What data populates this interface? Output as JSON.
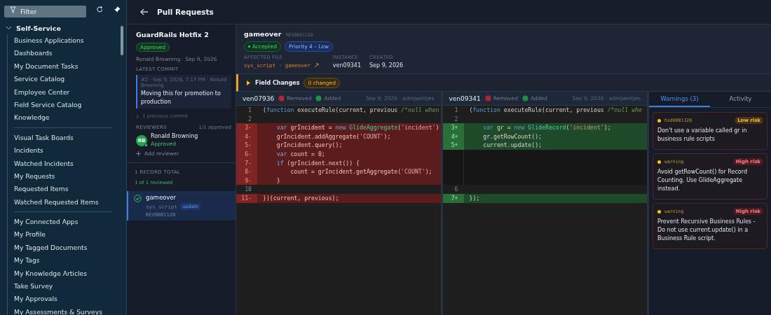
{
  "sidebar": {
    "filter": {
      "placeholder": "Filter"
    },
    "sections": [
      {
        "label": "Self-Service",
        "expanded": true,
        "groups": [
          [
            "Business Applications",
            "Dashboards",
            "My Document Tasks",
            "Service Catalog",
            "Employee Center",
            "Field Service Catalog",
            "Knowledge"
          ],
          [
            "Visual Task Boards",
            "Incidents",
            "Watched Incidents",
            "My Requests",
            "Requested Items",
            "Watched Requested Items"
          ],
          [
            "My Connected Apps",
            "My Profile",
            "My Tagged Documents",
            "My Tags",
            "My Knowledge Articles",
            "Take Survey",
            "My Approvals",
            "My Assessments & Surveys"
          ]
        ]
      }
    ]
  },
  "header": {
    "title": "Pull Requests"
  },
  "pull_request": {
    "title": "GuardRails Hotfix 2",
    "status": "Approved",
    "meta": "Ronald Browning · Sep 9, 2026",
    "latest_commit_label": "LATEST COMMIT",
    "commit": {
      "meta": "#2 · Sep 9, 2026, 7:17 PM · Ronald Browning",
      "message": "Moving this for promotion to production"
    },
    "previous_commits": "1 previous commit",
    "reviewers_label": "REVIEWERS",
    "reviewers_count": "1/1 approved",
    "reviewers": [
      {
        "initials": "RB",
        "name": "Ronald Browning",
        "status": "Approved"
      }
    ],
    "add_reviewer": "Add reviewer",
    "records_label": "1 RECORD TOTAL",
    "reviewed": "1 of 1 reviewed",
    "all_reviewed": true,
    "records": [
      {
        "name": "gameover",
        "table": "sys_script",
        "action": "update",
        "id": "REV0001120",
        "reviewed": true,
        "selected": true
      }
    ]
  },
  "record": {
    "name": "gameover",
    "id": "REV0001120",
    "status": "Accepted",
    "priority": "Priority 4 – Low",
    "fields": [
      {
        "label": "AFFECTED FILE",
        "value": "sys_script · gameover",
        "kind": "file"
      },
      {
        "label": "INSTANCE",
        "value": "ven09341",
        "kind": "plain"
      },
      {
        "label": "CREATED",
        "value": "Sep 9, 2026",
        "kind": "plain"
      }
    ]
  },
  "field_changes": {
    "label": "Field Changes",
    "count": "0 changed",
    "expanded": false
  },
  "diff_panes": [
    {
      "instance": "ven07936",
      "legend": [
        {
          "kind": "removed",
          "label": "Removed"
        },
        {
          "kind": "added",
          "label": "Added"
        }
      ],
      "meta": "Sep 9, 2026 · admjwintjes",
      "lines": [
        {
          "kind": "context",
          "num": "1",
          "tokens": [
            {
              "kind": "plain",
              "text": "("
            },
            {
              "kind": "kw",
              "text": "function"
            },
            {
              "kind": "plain",
              "text": " executeRule(current, previous "
            },
            {
              "kind": "comment",
              "text": "/*null when"
            }
          ]
        },
        {
          "kind": "context",
          "num": "2"
        },
        {
          "kind": "removed",
          "num": "3-",
          "tokens": [
            {
              "kind": "kw",
              "text": "    var"
            },
            {
              "kind": "plain",
              "text": " grIncident = "
            },
            {
              "kind": "kw",
              "text": "new "
            },
            {
              "kind": "cls",
              "text": "GlideAggregate"
            },
            {
              "kind": "plain",
              "text": "("
            },
            {
              "kind": "str",
              "text": "'incident'"
            },
            {
              "kind": "plain",
              "text": ")"
            }
          ]
        },
        {
          "kind": "removed",
          "num": "4-",
          "tokens": [
            {
              "kind": "plain",
              "text": "    grIncident.addAggregate("
            },
            {
              "kind": "str",
              "text": "'COUNT'"
            },
            {
              "kind": "plain",
              "text": ");"
            }
          ]
        },
        {
          "kind": "removed",
          "num": "5-",
          "tokens": [
            {
              "kind": "plain",
              "text": "    grIncident.query();"
            }
          ]
        },
        {
          "kind": "removed",
          "num": "6-",
          "tokens": [
            {
              "kind": "kw",
              "text": "    var"
            },
            {
              "kind": "plain",
              "text": " count = 0;"
            }
          ]
        },
        {
          "kind": "removed",
          "num": "7-",
          "tokens": [
            {
              "kind": "kw",
              "text": "    if"
            },
            {
              "kind": "plain",
              "text": " (grIncident.next()) {"
            }
          ]
        },
        {
          "kind": "removed",
          "num": "8-",
          "tokens": [
            {
              "kind": "plain",
              "text": "        count = grIncident.getAggregate("
            },
            {
              "kind": "str",
              "text": "'COUNT'"
            },
            {
              "kind": "plain",
              "text": ");"
            }
          ]
        },
        {
          "kind": "removed",
          "num": "9-",
          "tokens": [
            {
              "kind": "plain",
              "text": "    }"
            }
          ]
        },
        {
          "kind": "context",
          "num": "10"
        },
        {
          "kind": "removed",
          "num": "11-",
          "tokens": [
            {
              "kind": "plain",
              "text": "})(current, previous);"
            }
          ]
        }
      ]
    },
    {
      "instance": "ven09341",
      "legend": [
        {
          "kind": "removed",
          "label": "Removed"
        },
        {
          "kind": "added",
          "label": "Added"
        }
      ],
      "meta": "Sep 9, 2026 · admjwintjes",
      "lines": [
        {
          "kind": "context",
          "num": "1",
          "tokens": [
            {
              "kind": "plain",
              "text": "("
            },
            {
              "kind": "kw",
              "text": "function"
            },
            {
              "kind": "plain",
              "text": " executeRule(current, previous "
            },
            {
              "kind": "comment",
              "text": "/*null whe"
            }
          ]
        },
        {
          "kind": "context",
          "num": "2"
        },
        {
          "kind": "added",
          "num": "3+",
          "tokens": [
            {
              "kind": "kw",
              "text": "    var"
            },
            {
              "kind": "plain",
              "text": " gr = "
            },
            {
              "kind": "kw",
              "text": "new "
            },
            {
              "kind": "cls",
              "text": "GlideRecord"
            },
            {
              "kind": "plain",
              "text": "("
            },
            {
              "kind": "str",
              "text": "'incident'"
            },
            {
              "kind": "plain",
              "text": ");"
            }
          ]
        },
        {
          "kind": "added",
          "num": "4+",
          "tokens": [
            {
              "kind": "plain",
              "text": "    gr.getRowCount();"
            }
          ]
        },
        {
          "kind": "added",
          "num": "5+",
          "tokens": [
            {
              "kind": "plain",
              "text": "    current.update();"
            }
          ]
        },
        {
          "kind": "filler"
        },
        {
          "kind": "filler"
        },
        {
          "kind": "filler"
        },
        {
          "kind": "filler"
        },
        {
          "kind": "context",
          "num": "6"
        },
        {
          "kind": "added",
          "num": "7+",
          "tokens": [
            {
              "kind": "plain",
              "text": "});"
            }
          ]
        }
      ]
    }
  ],
  "side_panel": {
    "tabs": [
      {
        "label": "Warnings (3)",
        "selected": true
      },
      {
        "label": "Activity",
        "selected": false
      }
    ],
    "warnings": [
      {
        "source": "hsd0001320",
        "risk": "Low risk",
        "kind": "low",
        "text": "Don't use a variable called gr in business rule scripts"
      },
      {
        "source": "warning",
        "risk": "High risk",
        "kind": "high",
        "text": "Avoid getRowCount() for Record Counting. Use GlideAggregate instead."
      },
      {
        "source": "warning",
        "risk": "High risk",
        "kind": "high",
        "text": "Prevent Recursive Business Rules - Do not use current.update() in a Business Rule script."
      }
    ]
  }
}
